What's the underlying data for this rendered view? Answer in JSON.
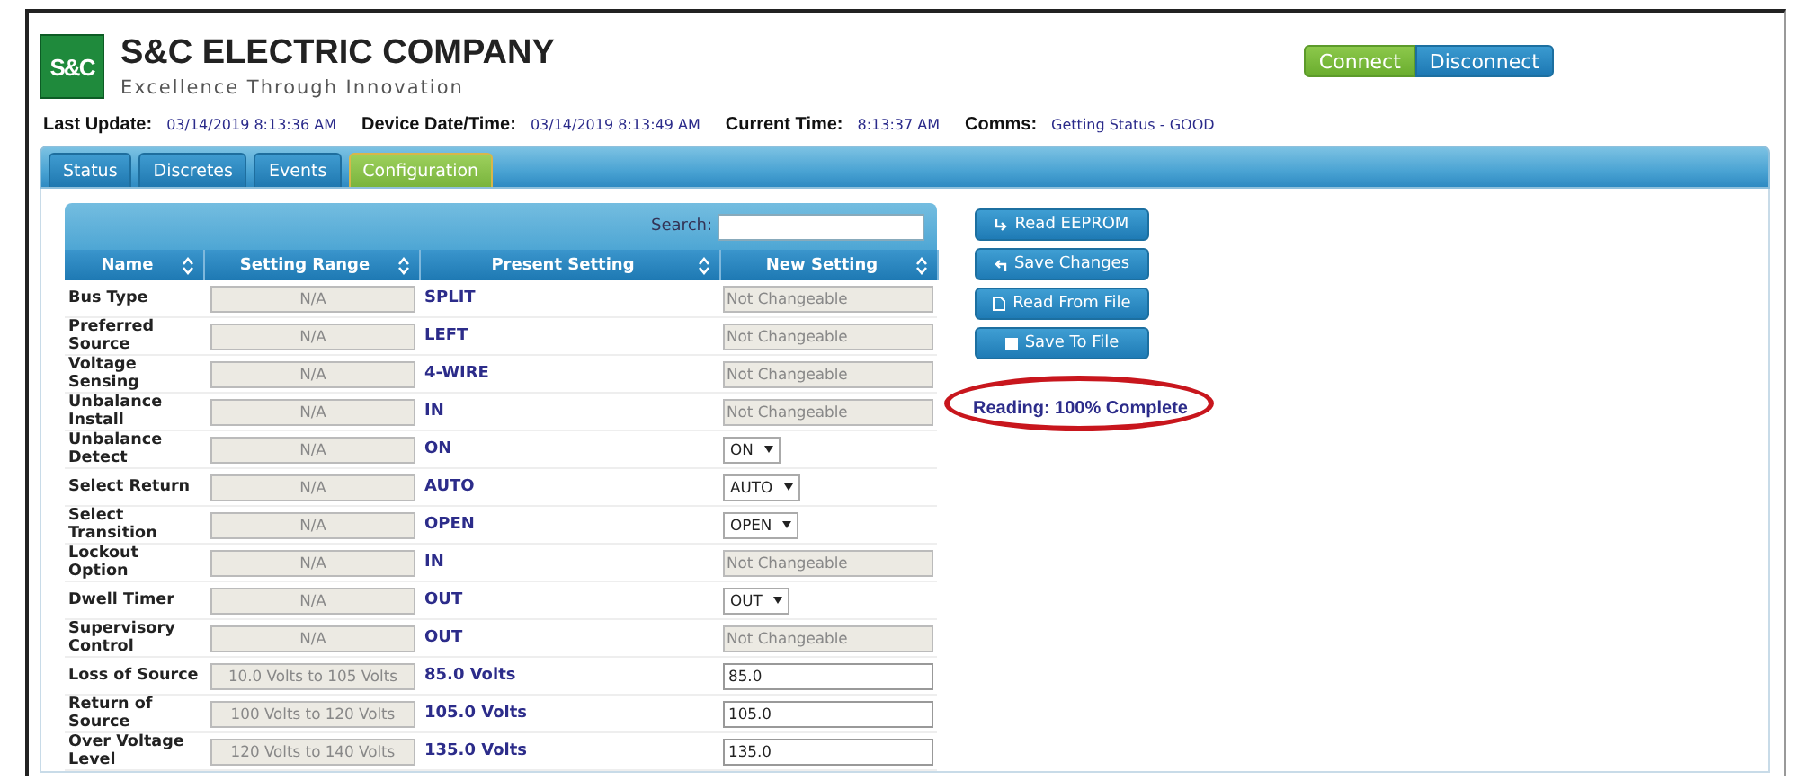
{
  "header": {
    "logo_text": "S&C",
    "company": "S&C ELECTRIC COMPANY",
    "tagline": "Excellence Through Innovation"
  },
  "connection": [
    {
      "label": "Connect",
      "selected": true
    },
    {
      "label": "Disconnect",
      "selected": false
    }
  ],
  "status_line": [
    {
      "label": "Last Update:",
      "value": "03/14/2019 8:13:36 AM"
    },
    {
      "label": "Device Date/Time:",
      "value": "03/14/2019 8:13:49 AM"
    },
    {
      "label": "Current Time:",
      "value": "8:13:37 AM"
    },
    {
      "label": "Comms:",
      "value": "Getting Status - GOOD"
    }
  ],
  "tabs": [
    {
      "label": "Status",
      "selected": false
    },
    {
      "label": "Discretes",
      "selected": false
    },
    {
      "label": "Events",
      "selected": false
    },
    {
      "label": "Configuration",
      "selected": true
    }
  ],
  "table": {
    "search_label": "Search:",
    "columns": [
      "Name",
      "Setting Range",
      "Present Setting",
      "New Setting"
    ],
    "rows": [
      {
        "name": "Bus Type",
        "range": "N/A",
        "present": "SPLIT",
        "new": {
          "kind": "fixed",
          "value": "Not Changeable"
        }
      },
      {
        "name": "Preferred Source",
        "range": "N/A",
        "present": "LEFT",
        "new": {
          "kind": "fixed",
          "value": "Not Changeable"
        }
      },
      {
        "name": "Voltage Sensing",
        "range": "N/A",
        "present": "4-WIRE",
        "new": {
          "kind": "fixed",
          "value": "Not Changeable"
        }
      },
      {
        "name": "Unbalance Install",
        "range": "N/A",
        "present": "IN",
        "new": {
          "kind": "fixed",
          "value": "Not Changeable"
        }
      },
      {
        "name": "Unbalance Detect",
        "range": "N/A",
        "present": "ON",
        "new": {
          "kind": "select",
          "value": "ON"
        }
      },
      {
        "name": "Select Return",
        "range": "N/A",
        "present": "AUTO",
        "new": {
          "kind": "select",
          "value": "AUTO"
        }
      },
      {
        "name": "Select Transition",
        "range": "N/A",
        "present": "OPEN",
        "new": {
          "kind": "select",
          "value": "OPEN"
        }
      },
      {
        "name": "Lockout Option",
        "range": "N/A",
        "present": "IN",
        "new": {
          "kind": "fixed",
          "value": "Not Changeable"
        }
      },
      {
        "name": "Dwell Timer",
        "range": "N/A",
        "present": "OUT",
        "new": {
          "kind": "select",
          "value": "OUT"
        }
      },
      {
        "name": "Supervisory Control",
        "range": "N/A",
        "present": "OUT",
        "new": {
          "kind": "fixed",
          "value": "Not Changeable"
        }
      },
      {
        "name": "Loss of Source",
        "range": "10.0 Volts to 105 Volts",
        "present": "85.0 Volts",
        "new": {
          "kind": "input",
          "value": "85.0"
        }
      },
      {
        "name": "Return of Source",
        "range": "100 Volts to 120 Volts",
        "present": "105.0 Volts",
        "new": {
          "kind": "input",
          "value": "105.0"
        }
      },
      {
        "name": "Over Voltage Level",
        "range": "120 Volts to 140 Volts",
        "present": "135.0 Volts",
        "new": {
          "kind": "input",
          "value": "135.0"
        }
      }
    ]
  },
  "actions": [
    {
      "kind": "read",
      "label": "Read EEPROM"
    },
    {
      "kind": "save",
      "label": "Save Changes"
    },
    {
      "kind": "file",
      "label": "Read From File"
    },
    {
      "kind": "disk",
      "label": "Save To File"
    }
  ],
  "progress_text": "Reading: 100% Complete"
}
